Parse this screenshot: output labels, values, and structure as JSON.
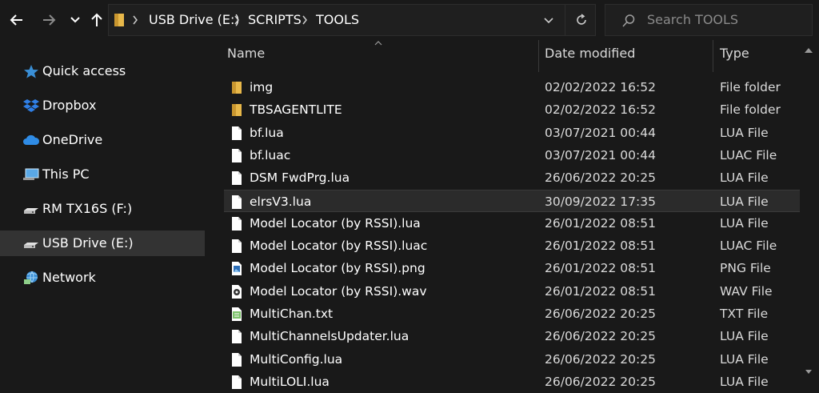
{
  "address": {
    "crumbs": [
      "USB Drive (E:)",
      "SCRIPTS",
      "TOOLS"
    ]
  },
  "search": {
    "placeholder": "Search TOOLS"
  },
  "sidebar": {
    "items": [
      {
        "label": "Quick access",
        "icon": "star-icon"
      },
      {
        "label": "Dropbox",
        "icon": "dropbox-icon"
      },
      {
        "label": "OneDrive",
        "icon": "cloud-icon"
      },
      {
        "label": "This PC",
        "icon": "computer-icon"
      },
      {
        "label": "RM TX16S (F:)",
        "icon": "drive-icon"
      },
      {
        "label": "USB Drive (E:)",
        "icon": "drive-icon",
        "selected": true
      },
      {
        "label": "Network",
        "icon": "network-icon"
      }
    ]
  },
  "columns": {
    "name": "Name",
    "date": "Date modified",
    "type": "Type"
  },
  "files": [
    {
      "name": "img",
      "date": "02/02/2022 16:52",
      "type": "File folder",
      "icon": "folder"
    },
    {
      "name": "TBSAGENTLITE",
      "date": "02/02/2022 16:52",
      "type": "File folder",
      "icon": "folder"
    },
    {
      "name": "bf.lua",
      "date": "03/07/2021 00:44",
      "type": "LUA File",
      "icon": "file"
    },
    {
      "name": "bf.luac",
      "date": "03/07/2021 00:44",
      "type": "LUAC File",
      "icon": "file"
    },
    {
      "name": "DSM FwdPrg.lua",
      "date": "26/06/2022 20:25",
      "type": "LUA File",
      "icon": "file"
    },
    {
      "name": "elrsV3.lua",
      "date": "30/09/2022 17:35",
      "type": "LUA File",
      "icon": "file",
      "selected": true
    },
    {
      "name": "Model Locator (by RSSI).lua",
      "date": "26/01/2022 08:51",
      "type": "LUA File",
      "icon": "file"
    },
    {
      "name": "Model Locator (by RSSI).luac",
      "date": "26/01/2022 08:51",
      "type": "LUAC File",
      "icon": "file"
    },
    {
      "name": "Model Locator (by RSSI).png",
      "date": "26/01/2022 08:51",
      "type": "PNG File",
      "icon": "image"
    },
    {
      "name": "Model Locator (by RSSI).wav",
      "date": "26/01/2022 08:51",
      "type": "WAV File",
      "icon": "audio"
    },
    {
      "name": "MultiChan.txt",
      "date": "26/06/2022 20:25",
      "type": "TXT File",
      "icon": "text"
    },
    {
      "name": "MultiChannelsUpdater.lua",
      "date": "26/06/2022 20:25",
      "type": "LUA File",
      "icon": "file"
    },
    {
      "name": "MultiConfig.lua",
      "date": "26/06/2022 20:25",
      "type": "LUA File",
      "icon": "file"
    },
    {
      "name": "MultiLOLI.lua",
      "date": "26/06/2022 20:25",
      "type": "LUA File",
      "icon": "file"
    }
  ],
  "colors": {
    "background": "#191919",
    "selected_bg": "#333333",
    "folder": "#e8b84a",
    "accent_blue": "#3a8fd6"
  }
}
